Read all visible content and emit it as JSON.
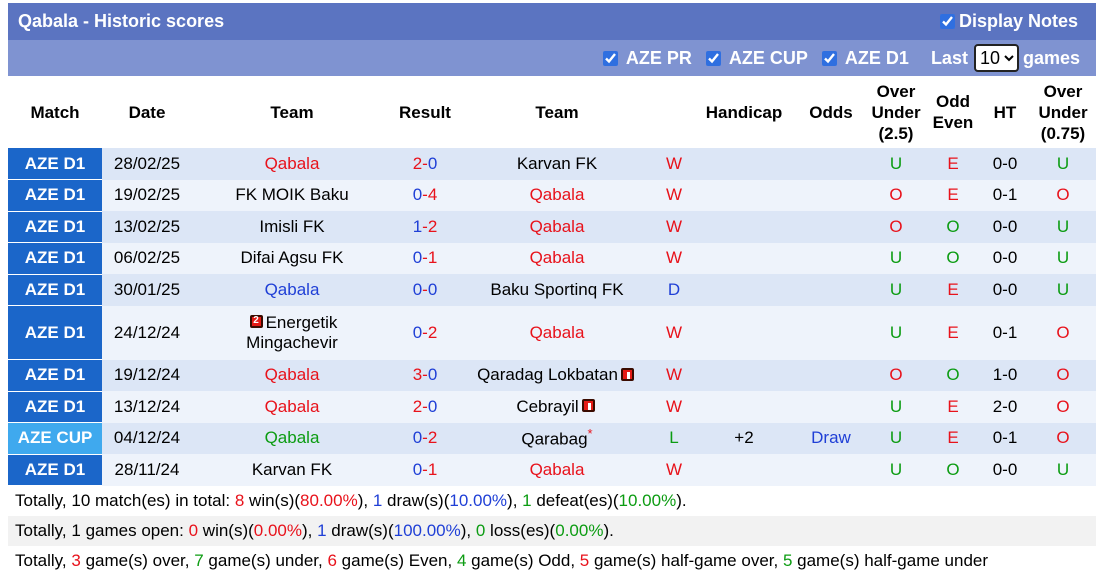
{
  "title": "Qabala - Historic scores",
  "display_notes": {
    "label": "Display Notes",
    "checked": true
  },
  "filters": [
    {
      "label": "AZE PR",
      "checked": true
    },
    {
      "label": "AZE CUP",
      "checked": true
    },
    {
      "label": "AZE D1",
      "checked": true
    }
  ],
  "last": {
    "prefix": "Last",
    "value": "10",
    "suffix": "games"
  },
  "columns": [
    "Match",
    "Date",
    "Team",
    "Result",
    "Team",
    "",
    "Handicap",
    "Odds",
    "Over Under (2.5)",
    "Odd Even",
    "HT",
    "Over Under (0.75)"
  ],
  "rows": [
    {
      "league": "AZE D1",
      "cup": false,
      "date": "28/02/25",
      "home": "Qabala",
      "home_color": "red",
      "home_card": "",
      "score_h": "2",
      "score_a": "0",
      "score_h_color": "red",
      "score_a_color": "blue",
      "away": "Karvan FK",
      "away_color": "black",
      "away_card": "",
      "away_star": "",
      "res": "W",
      "res_color": "red",
      "handicap": "",
      "odds": "",
      "ou": "U",
      "ou_color": "green",
      "oe": "E",
      "oe_color": "red",
      "ht": "0-0",
      "ou2": "U",
      "ou2_color": "green",
      "tall": false
    },
    {
      "league": "AZE D1",
      "cup": false,
      "date": "19/02/25",
      "home": "FK MOIK Baku",
      "home_color": "black",
      "home_card": "",
      "score_h": "0",
      "score_a": "4",
      "score_h_color": "blue",
      "score_a_color": "red",
      "away": "Qabala",
      "away_color": "red",
      "away_card": "",
      "away_star": "",
      "res": "W",
      "res_color": "red",
      "handicap": "",
      "odds": "",
      "ou": "O",
      "ou_color": "red",
      "oe": "E",
      "oe_color": "red",
      "ht": "0-1",
      "ou2": "O",
      "ou2_color": "red",
      "tall": false
    },
    {
      "league": "AZE D1",
      "cup": false,
      "date": "13/02/25",
      "home": "Imisli FK",
      "home_color": "black",
      "home_card": "",
      "score_h": "1",
      "score_a": "2",
      "score_h_color": "blue",
      "score_a_color": "red",
      "away": "Qabala",
      "away_color": "red",
      "away_card": "",
      "away_star": "",
      "res": "W",
      "res_color": "red",
      "handicap": "",
      "odds": "",
      "ou": "O",
      "ou_color": "red",
      "oe": "O",
      "oe_color": "green",
      "ht": "0-0",
      "ou2": "U",
      "ou2_color": "green",
      "tall": false
    },
    {
      "league": "AZE D1",
      "cup": false,
      "date": "06/02/25",
      "home": "Difai Agsu FK",
      "home_color": "black",
      "home_card": "",
      "score_h": "0",
      "score_a": "1",
      "score_h_color": "blue",
      "score_a_color": "red",
      "away": "Qabala",
      "away_color": "red",
      "away_card": "",
      "away_star": "",
      "res": "W",
      "res_color": "red",
      "handicap": "",
      "odds": "",
      "ou": "U",
      "ou_color": "green",
      "oe": "O",
      "oe_color": "green",
      "ht": "0-0",
      "ou2": "U",
      "ou2_color": "green",
      "tall": false
    },
    {
      "league": "AZE D1",
      "cup": false,
      "date": "30/01/25",
      "home": "Qabala",
      "home_color": "blue",
      "home_card": "",
      "score_h": "0",
      "score_a": "0",
      "score_h_color": "blue",
      "score_a_color": "blue",
      "away": "Baku Sportinq FK",
      "away_color": "black",
      "away_card": "",
      "away_star": "",
      "res": "D",
      "res_color": "blue",
      "handicap": "",
      "odds": "",
      "ou": "U",
      "ou_color": "green",
      "oe": "E",
      "oe_color": "red",
      "ht": "0-0",
      "ou2": "U",
      "ou2_color": "green",
      "tall": false
    },
    {
      "league": "AZE D1",
      "cup": false,
      "date": "24/12/24",
      "home": "Energetik Mingachevir",
      "home_color": "black",
      "home_card": "2",
      "score_h": "0",
      "score_a": "2",
      "score_h_color": "blue",
      "score_a_color": "red",
      "away": "Qabala",
      "away_color": "red",
      "away_card": "",
      "away_star": "",
      "res": "W",
      "res_color": "red",
      "handicap": "",
      "odds": "",
      "ou": "U",
      "ou_color": "green",
      "oe": "E",
      "oe_color": "red",
      "ht": "0-1",
      "ou2": "O",
      "ou2_color": "red",
      "tall": true
    },
    {
      "league": "AZE D1",
      "cup": false,
      "date": "19/12/24",
      "home": "Qabala",
      "home_color": "red",
      "home_card": "",
      "score_h": "3",
      "score_a": "0",
      "score_h_color": "red",
      "score_a_color": "blue",
      "away": "Qaradag Lokbatan",
      "away_color": "black",
      "away_card": "1",
      "away_star": "",
      "res": "W",
      "res_color": "red",
      "handicap": "",
      "odds": "",
      "ou": "O",
      "ou_color": "red",
      "oe": "O",
      "oe_color": "green",
      "ht": "1-0",
      "ou2": "O",
      "ou2_color": "red",
      "tall": false
    },
    {
      "league": "AZE D1",
      "cup": false,
      "date": "13/12/24",
      "home": "Qabala",
      "home_color": "red",
      "home_card": "",
      "score_h": "2",
      "score_a": "0",
      "score_h_color": "red",
      "score_a_color": "blue",
      "away": "Cebrayil",
      "away_color": "black",
      "away_card": "1",
      "away_star": "",
      "res": "W",
      "res_color": "red",
      "handicap": "",
      "odds": "",
      "ou": "U",
      "ou_color": "green",
      "oe": "E",
      "oe_color": "red",
      "ht": "2-0",
      "ou2": "O",
      "ou2_color": "red",
      "tall": false
    },
    {
      "league": "AZE CUP",
      "cup": true,
      "date": "04/12/24",
      "home": "Qabala",
      "home_color": "green",
      "home_card": "",
      "score_h": "0",
      "score_a": "2",
      "score_h_color": "blue",
      "score_a_color": "red",
      "away": "Qarabag",
      "away_color": "black",
      "away_card": "",
      "away_star": "*",
      "res": "L",
      "res_color": "green",
      "handicap": "+2",
      "odds": "Draw",
      "ou": "U",
      "ou_color": "green",
      "oe": "E",
      "oe_color": "red",
      "ht": "0-1",
      "ou2": "O",
      "ou2_color": "red",
      "tall": false
    },
    {
      "league": "AZE D1",
      "cup": false,
      "date": "28/11/24",
      "home": "Karvan FK",
      "home_color": "black",
      "home_card": "",
      "score_h": "0",
      "score_a": "1",
      "score_h_color": "blue",
      "score_a_color": "red",
      "away": "Qabala",
      "away_color": "red",
      "away_card": "",
      "away_star": "",
      "res": "W",
      "res_color": "red",
      "handicap": "",
      "odds": "",
      "ou": "U",
      "ou_color": "green",
      "oe": "O",
      "oe_color": "green",
      "ht": "0-0",
      "ou2": "U",
      "ou2_color": "green",
      "tall": false
    }
  ],
  "summary": [
    [
      {
        "t": "Totally, ",
        "c": ""
      },
      {
        "t": "10",
        "c": "b"
      },
      {
        "t": " match(es) in total: ",
        "c": ""
      },
      {
        "t": "8",
        "c": "red b"
      },
      {
        "t": " win(s)(",
        "c": ""
      },
      {
        "t": "80.00%",
        "c": "red b"
      },
      {
        "t": "), ",
        "c": ""
      },
      {
        "t": "1",
        "c": "blue b"
      },
      {
        "t": " draw(s)(",
        "c": ""
      },
      {
        "t": "10.00%",
        "c": "blue b"
      },
      {
        "t": "), ",
        "c": ""
      },
      {
        "t": "1",
        "c": "green b"
      },
      {
        "t": " defeat(es)(",
        "c": ""
      },
      {
        "t": "10.00%",
        "c": "green b"
      },
      {
        "t": ").",
        "c": ""
      }
    ],
    [
      {
        "t": "Totally, ",
        "c": ""
      },
      {
        "t": "1",
        "c": "b"
      },
      {
        "t": " games open: ",
        "c": ""
      },
      {
        "t": "0",
        "c": "red b"
      },
      {
        "t": " win(s)(",
        "c": ""
      },
      {
        "t": "0.00%",
        "c": "red b"
      },
      {
        "t": "), ",
        "c": ""
      },
      {
        "t": "1",
        "c": "blue b"
      },
      {
        "t": " draw(s)(",
        "c": ""
      },
      {
        "t": "100.00%",
        "c": "blue b"
      },
      {
        "t": "), ",
        "c": ""
      },
      {
        "t": "0",
        "c": "green b"
      },
      {
        "t": " loss(es)(",
        "c": ""
      },
      {
        "t": "0.00%",
        "c": "green b"
      },
      {
        "t": ").",
        "c": ""
      }
    ],
    [
      {
        "t": "Totally, ",
        "c": ""
      },
      {
        "t": "3",
        "c": "red b"
      },
      {
        "t": " game(s) over, ",
        "c": ""
      },
      {
        "t": "7",
        "c": "green b"
      },
      {
        "t": " game(s) under, ",
        "c": ""
      },
      {
        "t": "6",
        "c": "red b"
      },
      {
        "t": " game(s) Even, ",
        "c": ""
      },
      {
        "t": "4",
        "c": "green b"
      },
      {
        "t": " game(s) Odd, ",
        "c": ""
      },
      {
        "t": "5",
        "c": "red b"
      },
      {
        "t": " game(s) half-game over, ",
        "c": ""
      },
      {
        "t": "5",
        "c": "green b"
      },
      {
        "t": " game(s) half-game under",
        "c": ""
      }
    ]
  ],
  "colors": {
    "title_bg": "#5b74c1",
    "filter_bg": "#7f93d1",
    "league_bg": "#1b66c9",
    "cup_bg": "#3fa9ee",
    "red": "#e8121b",
    "blue": "#1f3fd6",
    "green": "#0c9c12"
  }
}
